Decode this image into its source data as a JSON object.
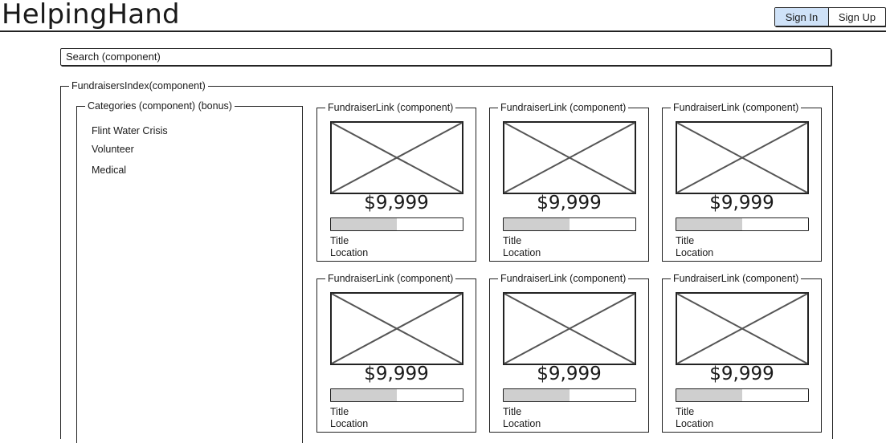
{
  "header": {
    "brand": "HelpingHand",
    "sign_in_label": "Sign In",
    "sign_up_label": "Sign Up"
  },
  "search": {
    "label": "Search (component)"
  },
  "index": {
    "label": "FundraisersIndex(component)"
  },
  "categories": {
    "label": "Categories (component) (bonus)",
    "items": [
      {
        "label": "Flint Water Crisis"
      },
      {
        "label": "Volunteer"
      },
      {
        "label": "Medical"
      }
    ]
  },
  "fundraisers": [
    {
      "label": "FundraiserLink (component)",
      "amount": "$9,999",
      "progress": 0.5,
      "title": "Title",
      "location": "Location"
    },
    {
      "label": "FundraiserLink (component)",
      "amount": "$9,999",
      "progress": 0.5,
      "title": "Title",
      "location": "Location"
    },
    {
      "label": "FundraiserLink (component)",
      "amount": "$9,999",
      "progress": 0.5,
      "title": "Title",
      "location": "Location"
    },
    {
      "label": "FundraiserLink (component)",
      "amount": "$9,999",
      "progress": 0.5,
      "title": "Title",
      "location": "Location"
    },
    {
      "label": "FundraiserLink (component)",
      "amount": "$9,999",
      "progress": 0.5,
      "title": "Title",
      "location": "Location"
    },
    {
      "label": "FundraiserLink (component)",
      "amount": "$9,999",
      "progress": 0.5,
      "title": "Title",
      "location": "Location"
    }
  ],
  "colors": {
    "sign_in_bg": "#cfe2f8",
    "progress_fill": "#cfcfcf",
    "placeholder_cross": "#555555"
  },
  "icons": {
    "card_image": "image-placeholder-icon"
  }
}
